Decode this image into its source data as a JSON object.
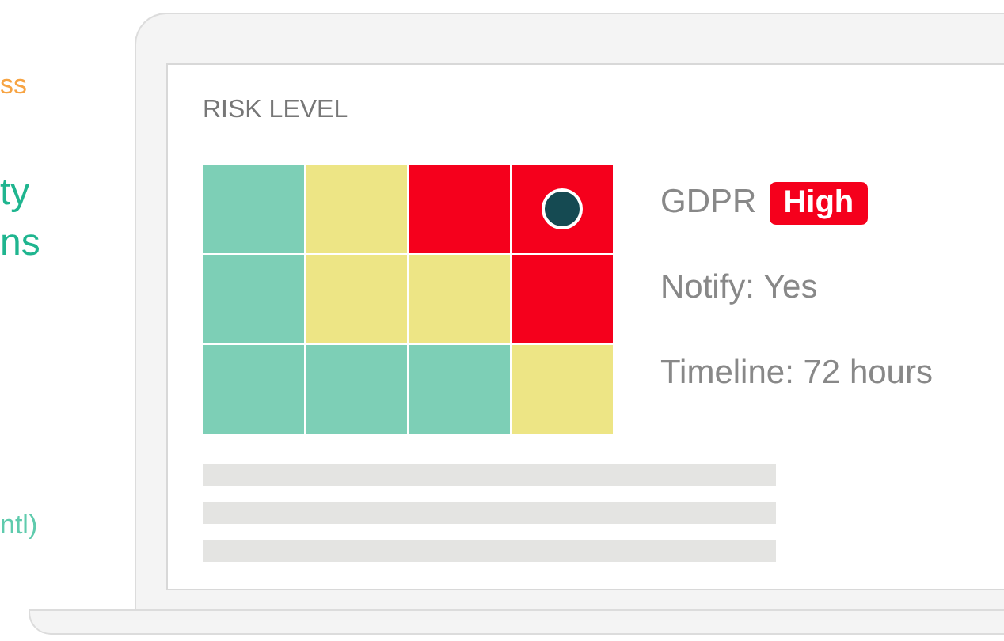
{
  "side_texts": [
    {
      "text": "ss",
      "color": "#f7a443"
    },
    {
      "text": "ty",
      "color": "#1fb58f"
    },
    {
      "text": "ns",
      "color": "#1fb58f"
    },
    {
      "text": "ntl)",
      "color": "#5fcbad"
    }
  ],
  "screen": {
    "title": "RISK LEVEL",
    "grid": [
      [
        {
          "color": "#7dcfb6",
          "selected": false
        },
        {
          "color": "#ede585",
          "selected": false
        },
        {
          "color": "#f5001c",
          "selected": false
        },
        {
          "color": "#f5001c",
          "selected": true
        }
      ],
      [
        {
          "color": "#7dcfb6",
          "selected": false
        },
        {
          "color": "#ede585",
          "selected": false
        },
        {
          "color": "#ede585",
          "selected": false
        },
        {
          "color": "#f5001c",
          "selected": false
        }
      ],
      [
        {
          "color": "#7dcfb6",
          "selected": false
        },
        {
          "color": "#7dcfb6",
          "selected": false
        },
        {
          "color": "#7dcfb6",
          "selected": false
        },
        {
          "color": "#ede585",
          "selected": false
        }
      ]
    ],
    "regulation": "GDPR",
    "badge": "High",
    "notify": "Notify: Yes",
    "timeline": "Timeline: 72 hours"
  }
}
